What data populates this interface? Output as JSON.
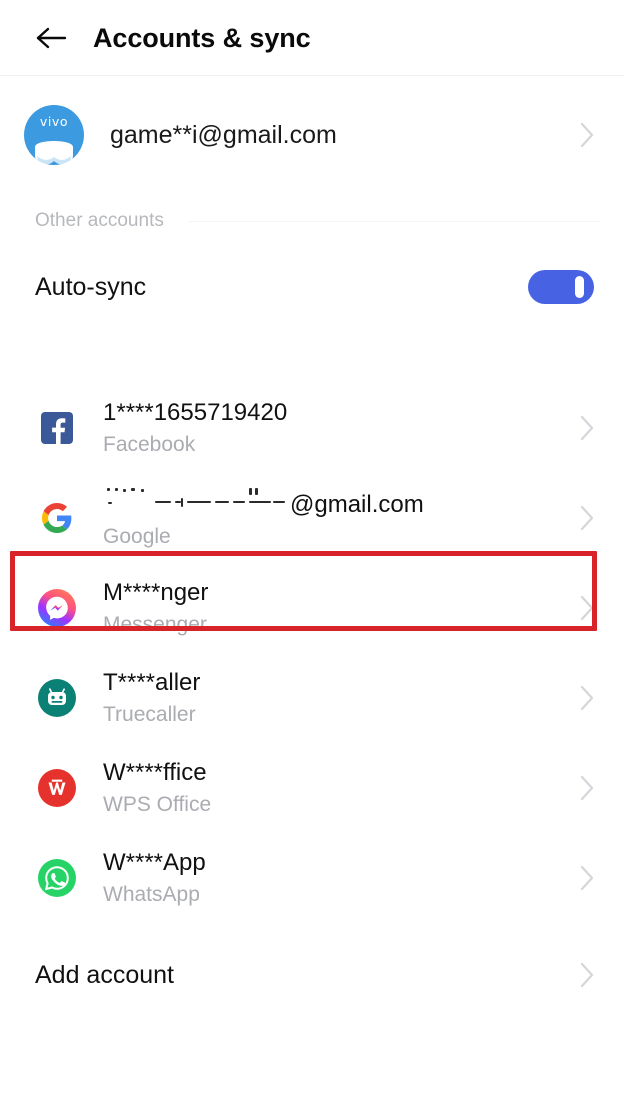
{
  "header": {
    "title": "Accounts & sync",
    "back_icon": "arrow-left-icon"
  },
  "primary_account": {
    "email": "game**i@gmail.com",
    "avatar_label": "vivo",
    "avatar_color": "#3c9ae0",
    "chevron_icon": "chevron-right-icon"
  },
  "section": {
    "label": "Other accounts"
  },
  "auto_sync": {
    "label": "Auto-sync",
    "enabled": true,
    "toggle_color": "#4763e4"
  },
  "accounts": [
    {
      "title": "1****1655719420",
      "subtitle": "Facebook",
      "icon": "facebook-icon",
      "icon_color": "#3b5998",
      "redacted": false,
      "highlighted": false
    },
    {
      "title": "@gmail.com",
      "subtitle": "Google",
      "icon": "google-icon",
      "icon_color": "#ffffff",
      "redacted": true,
      "highlighted": true
    },
    {
      "title": "M****nger",
      "subtitle": "Messenger",
      "icon": "messenger-icon",
      "icon_color": "#a033ff",
      "redacted": false,
      "highlighted": false
    },
    {
      "title": "T****aller",
      "subtitle": "Truecaller",
      "icon": "truecaller-icon",
      "icon_color": "#0a8174",
      "redacted": false,
      "highlighted": false
    },
    {
      "title": "W****ffice",
      "subtitle": "WPS Office",
      "icon": "wps-office-icon",
      "icon_color": "#e5322d",
      "redacted": false,
      "highlighted": false
    },
    {
      "title": "W****App",
      "subtitle": "WhatsApp",
      "icon": "whatsapp-icon",
      "icon_color": "#25d366",
      "redacted": false,
      "highlighted": false
    }
  ],
  "add_account": {
    "label": "Add account",
    "chevron_icon": "chevron-right-icon"
  },
  "highlight": {
    "color": "#d8232a"
  }
}
